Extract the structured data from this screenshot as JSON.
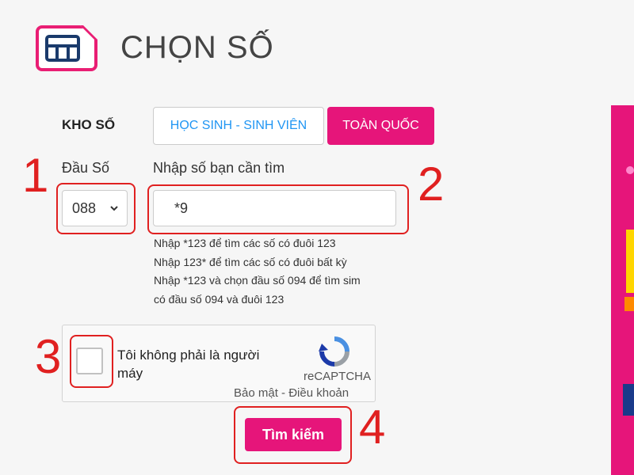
{
  "header": {
    "title": "CHỌN SỐ",
    "icon": "sim-card-icon"
  },
  "tabs": {
    "label": "KHO SỐ",
    "items": [
      {
        "label": "HỌC SINH - SINH VIÊN",
        "active": false
      },
      {
        "label": "TOÀN QUỐC",
        "active": true
      }
    ]
  },
  "prefix": {
    "label": "Đầu Số",
    "value": "088"
  },
  "search": {
    "label": "Nhập số bạn cần tìm",
    "value": "*9",
    "hints": [
      "Nhập *123 để tìm các số có đuôi 123",
      "Nhập 123* để tìm các số có đuôi bất kỳ",
      "Nhập *123 và chọn đầu số 094 để tìm sim",
      "có đầu số 094 và đuôi 123"
    ]
  },
  "captcha": {
    "label": "Tôi không phải là người máy",
    "brand": "reCAPTCHA",
    "privacy": "Bảo mật",
    "separator": " - ",
    "terms": "Điều khoản"
  },
  "submit": {
    "label": "Tìm kiếm"
  },
  "annotations": [
    "1",
    "2",
    "3",
    "4"
  ],
  "colors": {
    "accent": "#e6157a",
    "tab_link": "#2196f3",
    "annotation": "#e02020"
  }
}
